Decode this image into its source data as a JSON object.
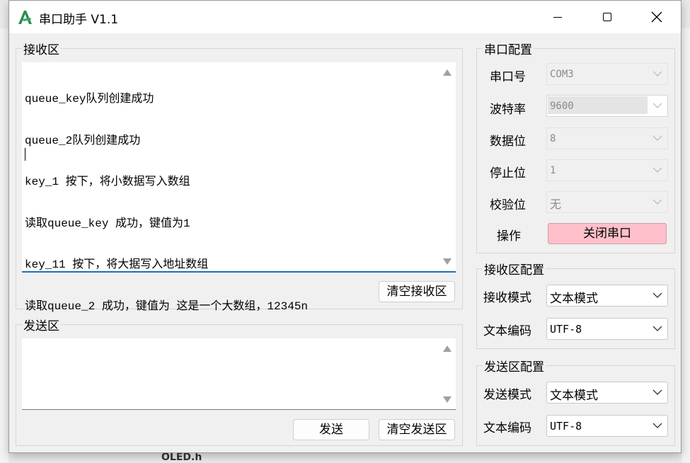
{
  "window": {
    "title": "串口助手 V1.1"
  },
  "receive": {
    "group_title": "接收区",
    "lines": [
      "queue_key队列创建成功",
      "queue_2队列创建成功",
      "key_1 按下，将小数据写入数组",
      "读取queue_key 成功，键值为1",
      "key_11 按下，将大据写入地址数组",
      "读取queue_2 成功，键值为 这是一个大数组，12345n"
    ],
    "clear_button": "清空接收区"
  },
  "send": {
    "group_title": "发送区",
    "send_button": "发送",
    "clear_button": "清空发送区"
  },
  "port_config": {
    "group_title": "串口配置",
    "port_label": "串口号",
    "port_value": "COM3",
    "baud_label": "波特率",
    "baud_value": "9600",
    "databits_label": "数据位",
    "databits_value": "8",
    "stopbits_label": "停止位",
    "stopbits_value": "1",
    "parity_label": "校验位",
    "parity_value": "无",
    "action_label": "操作",
    "action_button": "关闭串口"
  },
  "recv_config": {
    "group_title": "接收区配置",
    "mode_label": "接收模式",
    "mode_value": "文本模式",
    "encoding_label": "文本编码",
    "encoding_value": "UTF-8"
  },
  "send_config": {
    "group_title": "发送区配置",
    "mode_label": "发送模式",
    "mode_value": "文本模式",
    "encoding_label": "文本编码",
    "encoding_value": "UTF-8"
  },
  "background": {
    "file_label": "OLED.h"
  },
  "colors": {
    "close_port_bg": "#ffc0cb",
    "focus_underline": "#1f6fb8",
    "icon_green": "#2e8b57"
  }
}
